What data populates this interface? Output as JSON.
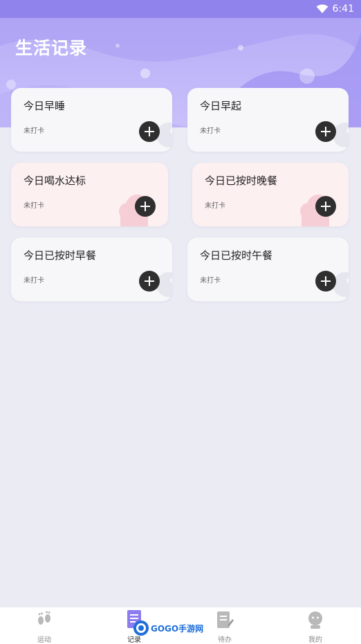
{
  "status_bar": {
    "time": "6:41"
  },
  "header": {
    "title": "生活记录"
  },
  "cards": [
    {
      "title": "今日早睡",
      "status": "未打卡"
    },
    {
      "title": "今日早起",
      "status": "未打卡"
    },
    {
      "title": "今日喝水达标",
      "status": "未打卡"
    },
    {
      "title": "今日已按时晚餐",
      "status": "未打卡"
    },
    {
      "title": "今日已按时早餐",
      "status": "未打卡"
    },
    {
      "title": "今日已按时午餐",
      "status": "未打卡"
    }
  ],
  "tabbar": {
    "tabs": [
      {
        "label": "运动",
        "icon": "footprints-icon"
      },
      {
        "label": "记录",
        "icon": "document-icon"
      },
      {
        "label": "待办",
        "icon": "todo-note-icon"
      },
      {
        "label": "我的",
        "icon": "profile-icon"
      }
    ],
    "active_index": 1
  },
  "watermark": {
    "text": "GOGO手游网"
  },
  "colors": {
    "header_top": "#9183ec",
    "header_light": "#c9c0fb",
    "accent_active_tab": "#8d7cf0",
    "add_button": "#2f2f2f",
    "pink_card": "#fdf0f1"
  }
}
